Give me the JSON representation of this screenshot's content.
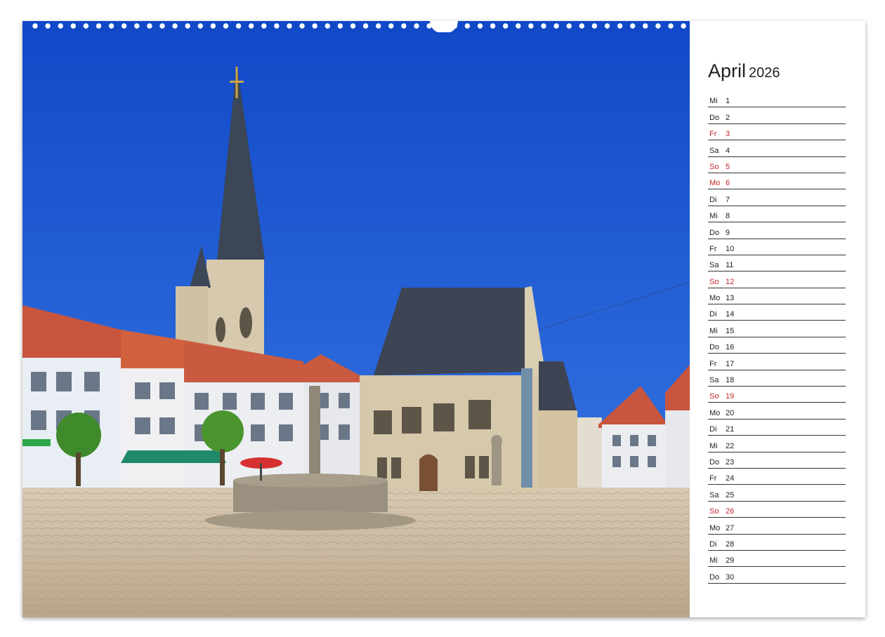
{
  "calendar": {
    "month": "April",
    "year": "2026",
    "days": [
      {
        "weekday": "Mi",
        "day": "1",
        "highlight": false
      },
      {
        "weekday": "Do",
        "day": "2",
        "highlight": false
      },
      {
        "weekday": "Fr",
        "day": "3",
        "highlight": true
      },
      {
        "weekday": "Sa",
        "day": "4",
        "highlight": false
      },
      {
        "weekday": "So",
        "day": "5",
        "highlight": true
      },
      {
        "weekday": "Mo",
        "day": "6",
        "highlight": true
      },
      {
        "weekday": "Di",
        "day": "7",
        "highlight": false
      },
      {
        "weekday": "Mi",
        "day": "8",
        "highlight": false
      },
      {
        "weekday": "Do",
        "day": "9",
        "highlight": false
      },
      {
        "weekday": "Fr",
        "day": "10",
        "highlight": false
      },
      {
        "weekday": "Sa",
        "day": "11",
        "highlight": false
      },
      {
        "weekday": "So",
        "day": "12",
        "highlight": true
      },
      {
        "weekday": "Mo",
        "day": "13",
        "highlight": false
      },
      {
        "weekday": "Di",
        "day": "14",
        "highlight": false
      },
      {
        "weekday": "Mi",
        "day": "15",
        "highlight": false
      },
      {
        "weekday": "Do",
        "day": "16",
        "highlight": false
      },
      {
        "weekday": "Fr",
        "day": "17",
        "highlight": false
      },
      {
        "weekday": "Sa",
        "day": "18",
        "highlight": false
      },
      {
        "weekday": "So",
        "day": "19",
        "highlight": true
      },
      {
        "weekday": "Mo",
        "day": "20",
        "highlight": false
      },
      {
        "weekday": "Di",
        "day": "21",
        "highlight": false
      },
      {
        "weekday": "Mi",
        "day": "22",
        "highlight": false
      },
      {
        "weekday": "Do",
        "day": "23",
        "highlight": false
      },
      {
        "weekday": "Fr",
        "day": "24",
        "highlight": false
      },
      {
        "weekday": "Sa",
        "day": "25",
        "highlight": false
      },
      {
        "weekday": "So",
        "day": "26",
        "highlight": true
      },
      {
        "weekday": "Mo",
        "day": "27",
        "highlight": false
      },
      {
        "weekday": "Di",
        "day": "28",
        "highlight": false
      },
      {
        "weekday": "Mi",
        "day": "29",
        "highlight": false
      },
      {
        "weekday": "Do",
        "day": "30",
        "highlight": false
      }
    ]
  },
  "colors": {
    "sky": "#1c5fd6",
    "holiday_red": "#c0282b",
    "rule_line": "#333333"
  },
  "photo": {
    "subject": "market-square-with-church-and-town-hall"
  }
}
